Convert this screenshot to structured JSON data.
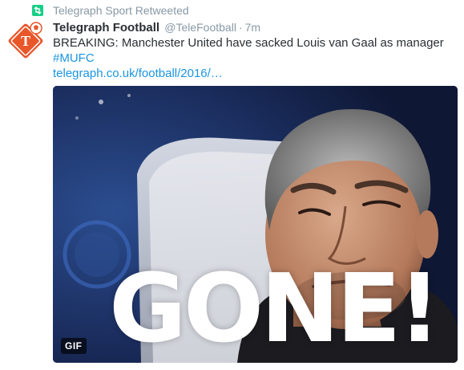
{
  "context": {
    "label": "Telegraph Sport Retweeted",
    "icon": "retweet-icon",
    "icon_color": "#19cf86"
  },
  "author": {
    "fullname": "Telegraph Football",
    "username": "@TeleFootball",
    "separator": "·",
    "time": "7m",
    "avatar_icon": "telegraph-football-logo-icon",
    "avatar_color": "#e8562a"
  },
  "tweet": {
    "text": "BREAKING: Manchester United have sacked Louis van Gaal as manager",
    "hashtag": "#MUFC",
    "link": "telegraph.co.uk/football/2016/…",
    "link_color": "#1b95e0"
  },
  "media": {
    "overlay_text": "GONE!",
    "badge": "GIF"
  }
}
